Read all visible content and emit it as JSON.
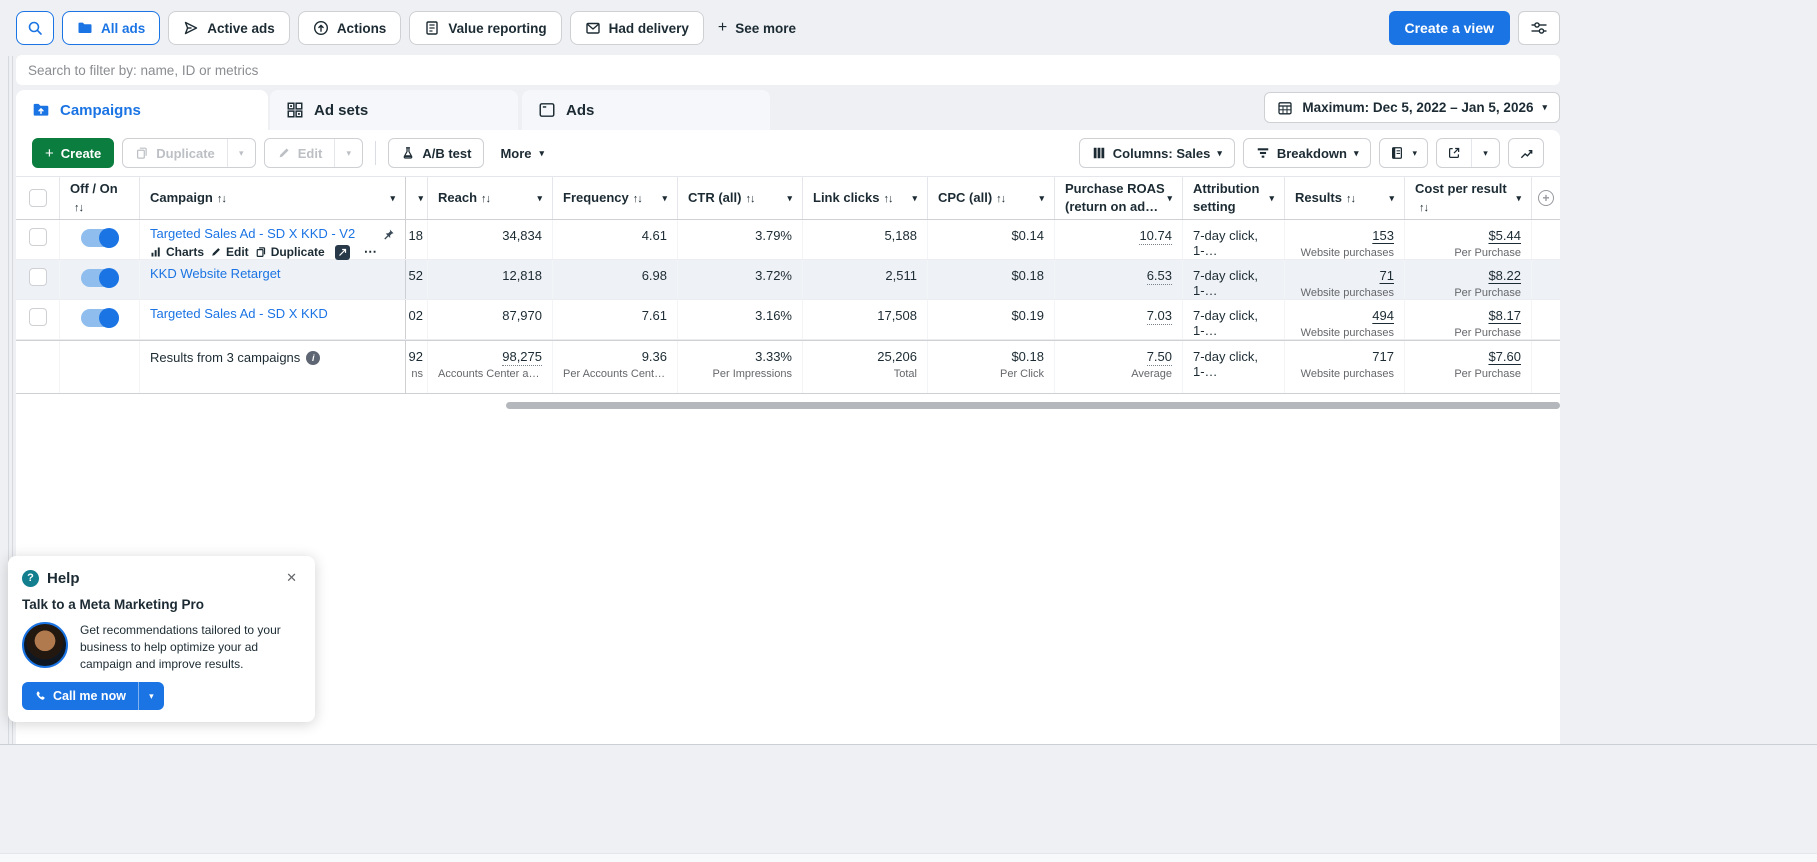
{
  "icons": {
    "caret": "▾",
    "sort": "↑↓",
    "plus": "+",
    "ellipsis": "⋯",
    "close": "✕",
    "question": "?",
    "info": "i"
  },
  "colors": {
    "accent": "#1b74e4",
    "green": "#0b7d3e",
    "teal": "#127e8e"
  },
  "filter_bar": {
    "chips": [
      {
        "label": "All ads"
      },
      {
        "label": "Active ads"
      },
      {
        "label": "Actions"
      },
      {
        "label": "Value reporting"
      },
      {
        "label": "Had delivery"
      }
    ],
    "see_more": "See more",
    "create_view": "Create a view"
  },
  "search": {
    "placeholder": "Search to filter by: name, ID or metrics"
  },
  "tabs": [
    {
      "label": "Campaigns"
    },
    {
      "label": "Ad sets"
    },
    {
      "label": "Ads"
    }
  ],
  "date_range": {
    "label": "Maximum: Dec 5, 2022 – Jan 5, 2026"
  },
  "toolbar": {
    "create": "Create",
    "duplicate": "Duplicate",
    "edit": "Edit",
    "ab_test": "A/B test",
    "more": "More",
    "columns": "Columns: Sales",
    "breakdown": "Breakdown"
  },
  "table": {
    "headers": {
      "off_on": "Off / On",
      "campaign": "Campaign",
      "reach": "Reach",
      "frequency": "Frequency",
      "ctr": "CTR (all)",
      "link_clicks": "Link clicks",
      "cpc": "CPC (all)",
      "roas_1": "Purchase ROAS",
      "roas_2": "(return on ad…",
      "attribution_1": "Attribution",
      "attribution_2": "setting",
      "results": "Results",
      "cost": "Cost per result"
    },
    "row_actions": {
      "charts": "Charts",
      "edit": "Edit",
      "duplicate": "Duplicate"
    },
    "rows": [
      {
        "name": "Targeted Sales Ad - SD X KKD - V2",
        "hidden": "18",
        "reach": "34,834",
        "frequency": "4.61",
        "ctr": "3.79%",
        "link_clicks": "5,188",
        "cpc": "$0.14",
        "roas": "10.74",
        "attribution": "7-day click, 1-…",
        "results": "153",
        "results_sub": "Website purchases",
        "cost": "$5.44",
        "cost_sub": "Per Purchase"
      },
      {
        "name": "KKD Website Retarget",
        "hidden": "52",
        "reach": "12,818",
        "frequency": "6.98",
        "ctr": "3.72%",
        "link_clicks": "2,511",
        "cpc": "$0.18",
        "roas": "6.53",
        "attribution": "7-day click, 1-…",
        "results": "71",
        "results_sub": "Website purchases",
        "cost": "$8.22",
        "cost_sub": "Per Purchase"
      },
      {
        "name": "Targeted Sales Ad - SD X KKD",
        "hidden": "02",
        "reach": "87,970",
        "frequency": "7.61",
        "ctr": "3.16%",
        "link_clicks": "17,508",
        "cpc": "$0.19",
        "roas": "7.03",
        "attribution": "7-day click, 1-…",
        "results": "494",
        "results_sub": "Website purchases",
        "cost": "$8.17",
        "cost_sub": "Per Purchase"
      }
    ],
    "summary": {
      "label": "Results from 3 campaigns",
      "hidden": "92",
      "hidden_sub": "ns",
      "reach": "98,275",
      "reach_sub": "Accounts Center acco…",
      "frequency": "9.36",
      "frequency_sub": "Per Accounts Center …",
      "ctr": "3.33%",
      "ctr_sub": "Per Impressions",
      "link_clicks": "25,206",
      "link_clicks_sub": "Total",
      "cpc": "$0.18",
      "cpc_sub": "Per Click",
      "roas": "7.50",
      "roas_sub": "Average",
      "attribution": "7-day click, 1-…",
      "results": "717",
      "results_sub": "Website purchases",
      "cost": "$7.60",
      "cost_sub": "Per Purchase"
    }
  },
  "help": {
    "title": "Help",
    "heading": "Talk to a Meta Marketing Pro",
    "body": "Get recommendations tailored to your business to help optimize your ad campaign and improve results.",
    "call_button": "Call me now"
  }
}
